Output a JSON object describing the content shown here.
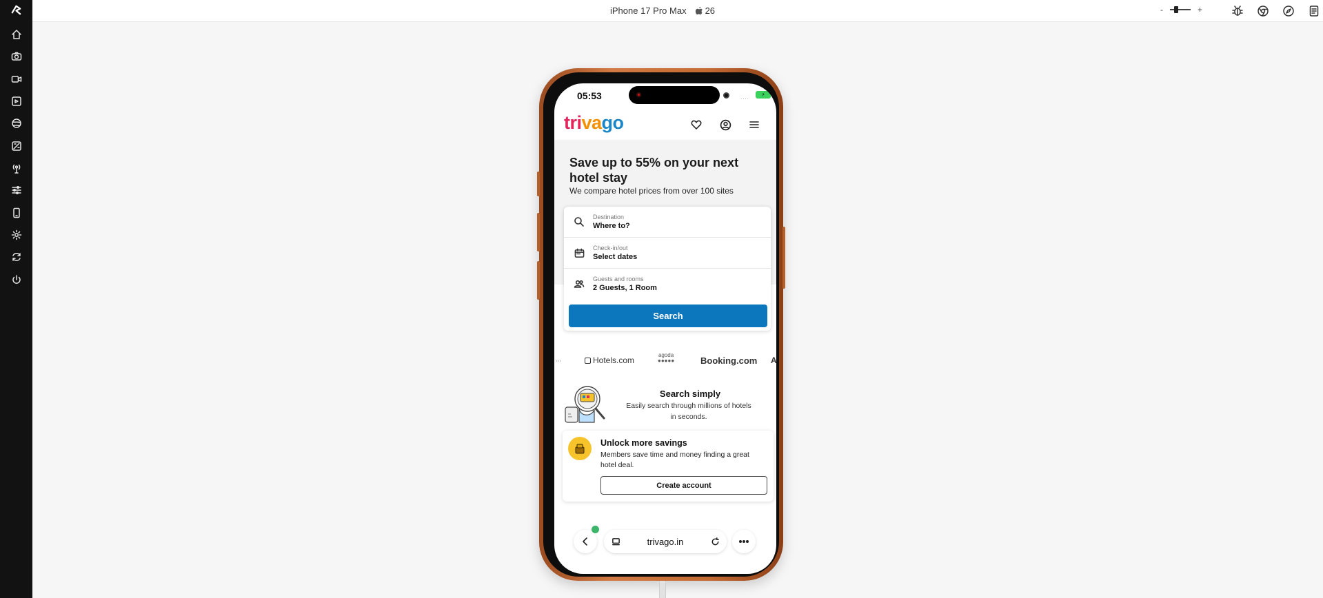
{
  "toolbar": {
    "device_name": "iPhone 17 Pro Max",
    "os_version": "26",
    "zoom_minus": "-",
    "zoom_plus": "+"
  },
  "rail": {
    "items": [
      "home-icon",
      "camera-icon",
      "video-icon",
      "media-icon",
      "globe-icon",
      "image-edit-icon",
      "antenna-icon",
      "sliders-icon",
      "device-icon",
      "settings-icon",
      "sync-icon",
      "power-icon"
    ]
  },
  "phone": {
    "status": {
      "time": "05:53",
      "signal": "...."
    },
    "app": {
      "brand": {
        "part1": "tri",
        "part2": "va",
        "part3": "go"
      },
      "headline": "Save up to 55% on your next hotel stay",
      "subhead": "We compare hotel prices from over 100 sites",
      "search": {
        "destination_label": "Destination",
        "destination_value": "Where to?",
        "dates_label": "Check-in/out",
        "dates_value": "Select dates",
        "guests_label": "Guests and rooms",
        "guests_value": "2 Guests, 1 Room",
        "button": "Search"
      },
      "partners": {
        "hotels": "Hotels.com",
        "agoda": "agoda",
        "booking": "Booking.com"
      },
      "feature": {
        "title": "Search simply",
        "description": "Easily search through millions of hotels in seconds."
      },
      "unlock": {
        "title": "Unlock more savings",
        "description": "Members save time and money finding a great hotel deal.",
        "button": "Create account"
      }
    },
    "browser": {
      "url": "trivago.in"
    }
  },
  "colors": {
    "accent": "#0d77bd",
    "brand_red": "#e3265c",
    "brand_orange": "#f48f00",
    "brand_blue": "#1b87c9",
    "phone_frame": "#c46a33"
  }
}
